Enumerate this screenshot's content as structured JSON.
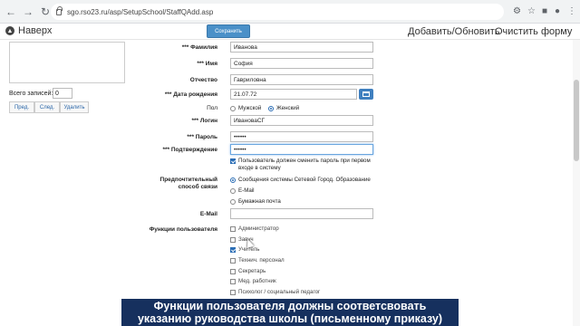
{
  "browser": {
    "url": "sgo.rso23.ru/asp/SetupSchool/StaffQAdd.asp"
  },
  "header": {
    "back_label": "Наверх",
    "save_label": "Сохранить",
    "add_update_label": "Добавить/Обновить",
    "clear_form_label": "Очистить форму"
  },
  "left": {
    "records_label": "Всего записей:",
    "records_count": "0",
    "prev_label": "Пред.",
    "next_label": "След.",
    "delete_label": "Удалить"
  },
  "form": {
    "lastname_label": "*** Фамилия",
    "lastname_value": "Иванова",
    "firstname_label": "*** Имя",
    "firstname_value": "София",
    "patronymic_label": "Отчество",
    "patronymic_value": "Гавриловна",
    "birthdate_label": "*** Дата рождения",
    "birthdate_value": "21.07.72",
    "gender_label": "Пол",
    "gender_male": "Мужской",
    "gender_female": "Женский",
    "gender_selected": "Женский",
    "login_label": "*** Логин",
    "login_value": "ИвановаСГ",
    "password_label": "*** Пароль",
    "password_value": "••••••",
    "confirm_label": "*** Подтверждение",
    "confirm_value": "••••••",
    "must_change_line1": "Пользователь должен сменить пароль при первом",
    "must_change_line2": "входе в систему",
    "must_change_checked": true,
    "contact_label_line1": "Предпочтительный",
    "contact_label_line2": "способ связи",
    "contact_options": [
      "Сообщения системы Сетевой Город. Образование",
      "E-Mail",
      "Бумажная почта"
    ],
    "contact_selected": 0,
    "email_label": "E-Mail",
    "email_value": "",
    "roles_label": "Функции пользователя",
    "roles": [
      {
        "label": "Администратор",
        "checked": false
      },
      {
        "label": "Завуч",
        "checked": false
      },
      {
        "label": "Учитель",
        "checked": true
      },
      {
        "label": "Технич. персонал",
        "checked": false
      },
      {
        "label": "Секретарь",
        "checked": false
      },
      {
        "label": "Мед. работник",
        "checked": false
      },
      {
        "label": "Психолог / социальный педагог",
        "checked": false
      }
    ]
  },
  "caption": {
    "line1": "Функции пользователя должны соответсвовать",
    "line2": "указанию руководства школы (письменному приказу)"
  },
  "colors": {
    "accent": "#2a6db5",
    "save_button": "#4a90c8",
    "banner": "#16305e"
  }
}
